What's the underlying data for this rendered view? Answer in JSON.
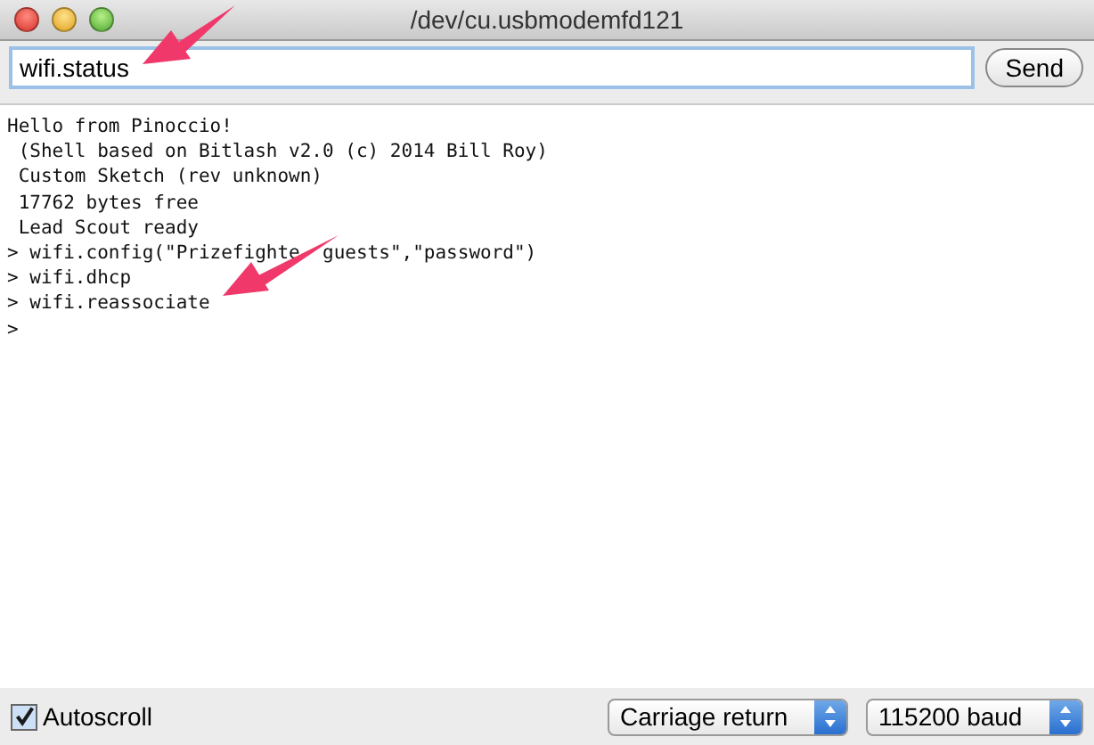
{
  "window": {
    "title": "/dev/cu.usbmodemfd121"
  },
  "input": {
    "value": "wifi.status"
  },
  "send_button": "Send",
  "output_lines": [
    "Hello from Pinoccio!",
    " (Shell based on Bitlash v2.0 (c) 2014 Bill Roy)",
    " Custom Sketch (rev unknown)",
    " 17762 bytes free",
    " Lead Scout ready",
    [
      "> wifi.config(\"Prizefighte",
      "guests\",\"password\")"
    ],
    "> wifi.dhcp",
    "> wifi.reassociate",
    ">"
  ],
  "autoscroll": {
    "label": "Autoscroll",
    "checked": true
  },
  "line_ending": {
    "value": "Carriage return"
  },
  "baud_rate": {
    "value": "115200 baud"
  }
}
